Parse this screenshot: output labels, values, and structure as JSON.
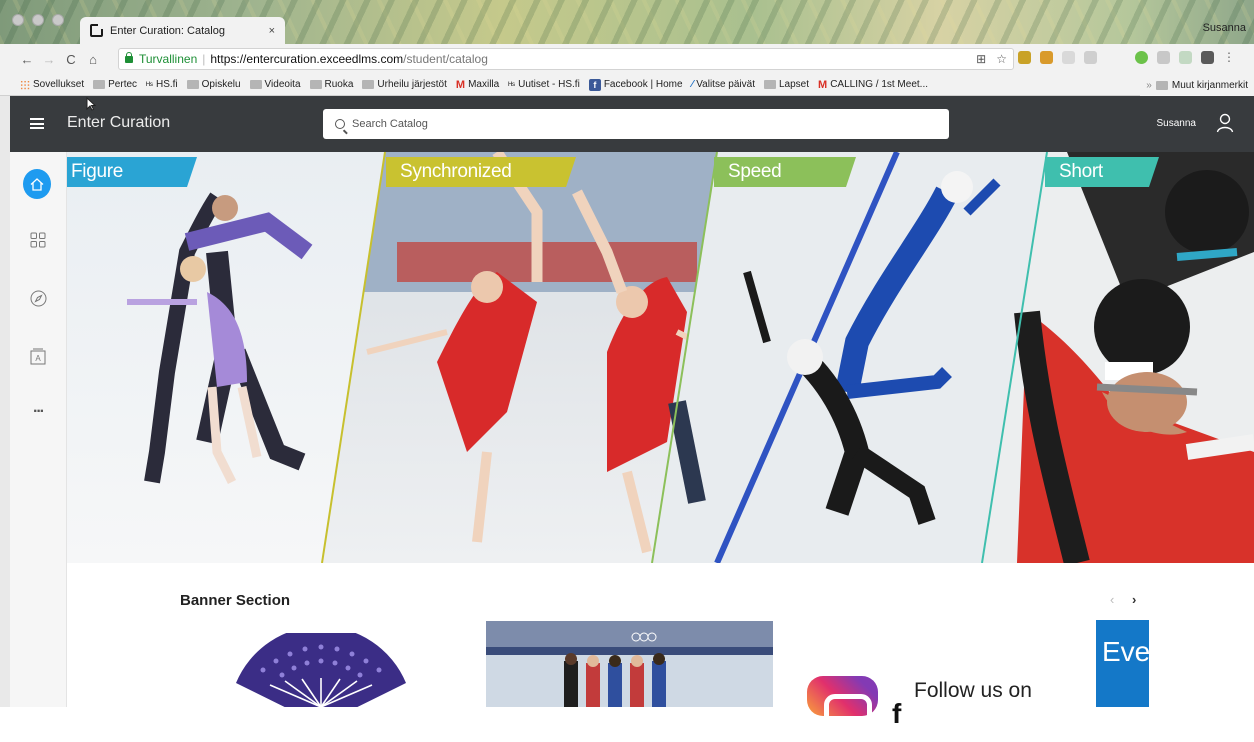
{
  "browser": {
    "tab_title": "Enter Curation: Catalog",
    "tab_close": "×",
    "profile": "Susanna",
    "secure_label": "Turvallinen",
    "url_host": "https://entercuration.exceedlms.com",
    "url_path": "/student/catalog",
    "bookmarks": [
      {
        "label": "Sovellukset",
        "icon": "apps-icon"
      },
      {
        "label": "Pertec",
        "icon": "folder-icon"
      },
      {
        "label": "HS.fi",
        "icon": "hs-icon"
      },
      {
        "label": "Opiskelu",
        "icon": "folder-icon"
      },
      {
        "label": "Videoita",
        "icon": "folder-icon"
      },
      {
        "label": "Ruoka",
        "icon": "folder-icon"
      },
      {
        "label": "Urheilu järjestöt",
        "icon": "folder-icon"
      },
      {
        "label": "Maxilla",
        "icon": "gmail-icon"
      },
      {
        "label": "Uutiset - HS.fi",
        "icon": "hs-icon"
      },
      {
        "label": "Facebook | Home",
        "icon": "facebook-icon"
      },
      {
        "label": "Valitse päivät",
        "icon": "doodle-icon"
      },
      {
        "label": "Lapset",
        "icon": "folder-icon"
      },
      {
        "label": "CALLING / 1st Meet...",
        "icon": "gmail-icon"
      }
    ],
    "bookmarks_more": "»",
    "bookmarks_other": "Muut kirjanmerkit"
  },
  "app": {
    "brand": "Enter Curation",
    "search_placeholder": "Search Catalog",
    "user_name": "Susanna"
  },
  "rail": {
    "items": [
      "home-icon",
      "grid-icon",
      "compass-icon",
      "certificate-icon",
      "more-icon"
    ],
    "more_label": "···"
  },
  "hero": {
    "panels": [
      {
        "label": "Figure Skating",
        "color": "#2aa4d4"
      },
      {
        "label": "Synchronized Skating",
        "color": "#c9c230"
      },
      {
        "label": "Speed Skating",
        "color": "#8cc05a"
      },
      {
        "label": "Short Track",
        "color": "#3fbfae"
      }
    ]
  },
  "banner": {
    "title": "Banner Section",
    "prev": "‹",
    "next": "›",
    "follow_text": "Follow us on",
    "follow_big": "f",
    "eve_text": "Eve"
  },
  "colors": {
    "header_bg": "#383b3e",
    "accent_blue": "#1e9bf0"
  }
}
